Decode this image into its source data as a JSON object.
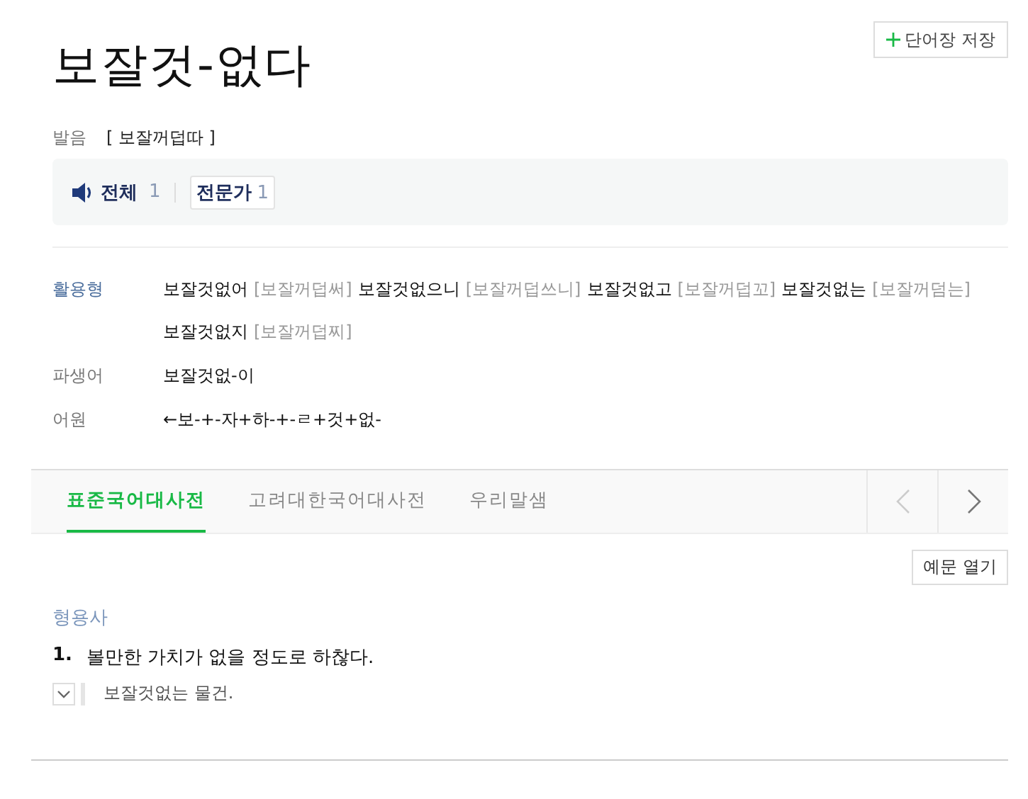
{
  "save_button": {
    "label": "단어장 저장"
  },
  "headword": "보잘것-없다",
  "pronunciation": {
    "label": "발음",
    "value": "[ 보잘꺼덥따 ]"
  },
  "audio": {
    "all_label": "전체",
    "all_count": "1",
    "expert_label": "전문가",
    "expert_count": "1"
  },
  "conjugation": {
    "label": "활용형",
    "forms": [
      {
        "form": "보잘것없어",
        "pron": "[보잘꺼덥써]"
      },
      {
        "form": "보잘것없으니",
        "pron": "[보잘꺼덥쓰니]"
      },
      {
        "form": "보잘것없고",
        "pron": "[보잘꺼덥꼬]"
      },
      {
        "form": "보잘것없는",
        "pron": "[보잘꺼덤는]"
      },
      {
        "form": "보잘것없지",
        "pron": "[보잘꺼덥찌]"
      }
    ]
  },
  "derivative": {
    "label": "파생어",
    "value": "보잘것없-이"
  },
  "etymology": {
    "label": "어원",
    "value": "←보-+-자+하-+-ㄹ+것+없-"
  },
  "tabs": [
    {
      "label": "표준국어대사전",
      "selected": true
    },
    {
      "label": "고려대한국어대사전",
      "selected": false
    },
    {
      "label": "우리말샘",
      "selected": false
    }
  ],
  "nav": {
    "prev_disabled": true,
    "next_disabled": false
  },
  "examples_button": {
    "label": "예문 열기"
  },
  "pos": "형용사",
  "senses": [
    {
      "number": "1.",
      "definition": "볼만한 가치가 없을 정도로 하찮다.",
      "examples": [
        "보잘것없는 물건."
      ]
    }
  ]
}
